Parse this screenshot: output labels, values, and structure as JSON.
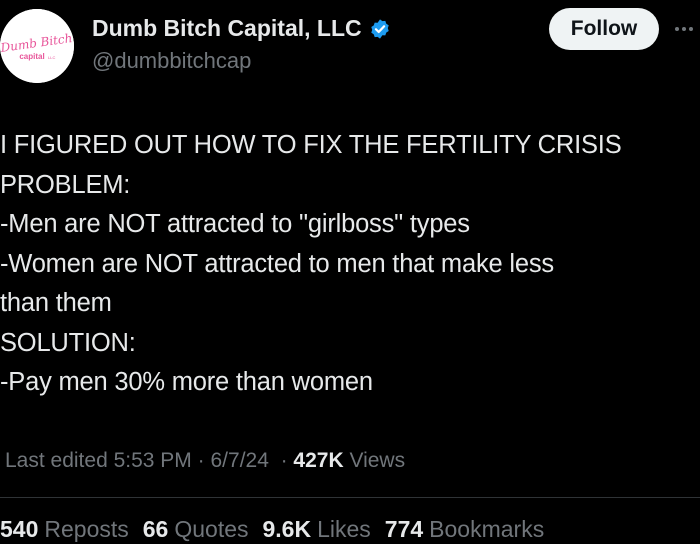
{
  "author": {
    "avatar_script_text": "Dumb Bitch",
    "avatar_sub_text": "capital",
    "avatar_sub_small": "LLC",
    "display_name": "Dumb Bitch Capital, LLC",
    "handle": "@dumbbitchcap",
    "verified_icon": "verified-badge-icon",
    "verified_color": "#1d9bf0"
  },
  "follow_label": "Follow",
  "more_icon": "more-options-icon",
  "tweet_lines": [
    "I FIGURED OUT HOW TO FIX THE FERTILITY CRISIS",
    "PROBLEM:",
    "-Men are NOT attracted to \"girlboss\" types",
    "-Women are NOT attracted to men that make less",
    "than them",
    "SOLUTION:",
    "-Pay men 30% more than women"
  ],
  "meta": {
    "edited_label": "Last edited",
    "time": "5:53 PM",
    "date": "6/7/24",
    "separator": "·",
    "views_count": "427K",
    "views_label": "Views"
  },
  "stats": [
    {
      "count": "540",
      "label": "Reposts"
    },
    {
      "count": "66",
      "label": "Quotes"
    },
    {
      "count": "9.6K",
      "label": "Likes"
    },
    {
      "count": "774",
      "label": "Bookmarks"
    }
  ],
  "colors": {
    "background": "#000000",
    "text": "#e7e9ea",
    "secondary": "#71767b",
    "avatar_pink": "#e8559a"
  }
}
